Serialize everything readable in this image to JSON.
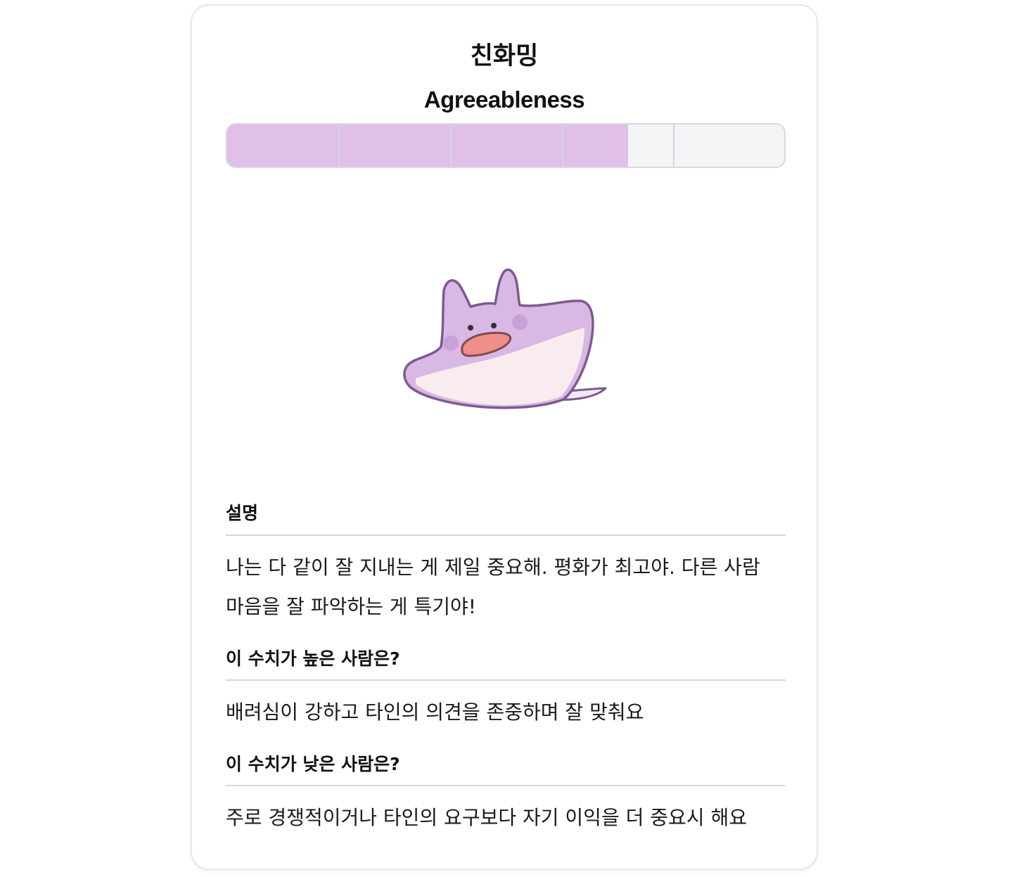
{
  "header": {
    "title_ko": "친화밍",
    "title_en": "Agreeableness"
  },
  "score": {
    "filled_segments_fraction": 0.72,
    "segments": 5,
    "fill_color": "#e0bfe8",
    "empty_color": "#f3f4f6"
  },
  "mascot": {
    "icon": "purple-manta-ray-character-icon"
  },
  "description": {
    "title": "설명",
    "text_line1": "나는 다 같이 잘 지내는 게 제일 중요해. 평화가 최고야. 다른 사람",
    "text_line2": "마음을 잘 파악하는 게 특기야!"
  },
  "high": {
    "title": "이 수치가 높은 사람은?",
    "text": "배려심이 강하고 타인의 의견을 존중하며 잘 맞춰요"
  },
  "low": {
    "title": "이 수치가 낮은 사람은?",
    "text": "주로 경쟁적이거나 타인의 요구보다 자기 이익을 더 중요시 해요"
  }
}
